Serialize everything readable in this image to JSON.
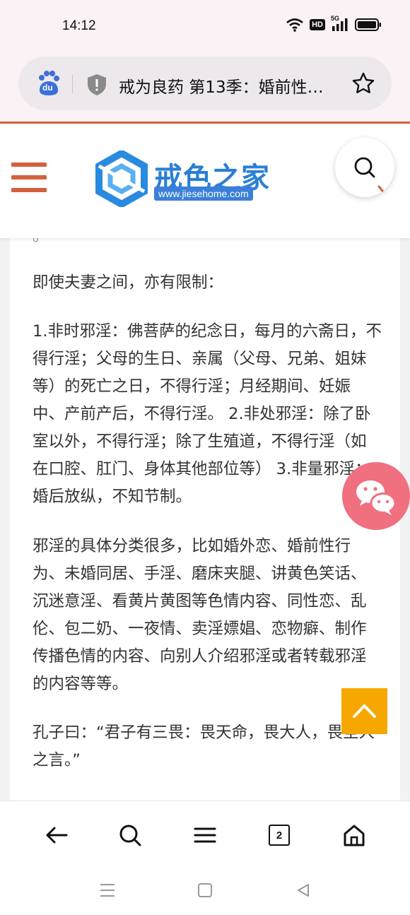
{
  "status_bar": {
    "time": "14:12",
    "icons": [
      "wifi-icon",
      "hd-icon",
      "5g-signal-icon",
      "battery-icon"
    ],
    "hd_label": "HD",
    "network_label": "5G"
  },
  "browser": {
    "page_title": "戒为良药 第13季：婚前性…",
    "engine_icon": "baidu-paw-icon",
    "engine_label": "du"
  },
  "site": {
    "logo_name": "戒色之家",
    "logo_url": "www.jiesehome.com",
    "accent_color": "#d4603c",
    "brand_color": "#2a7fd4"
  },
  "article": {
    "cut_line": "。",
    "paragraphs": [
      "即使夫妻之间，亦有限制：",
      "1.非时邪淫：佛菩萨的纪念日，每月的六斋日，不得行淫；父母的生日、亲属（父母、兄弟、姐妹等）的死亡之日，不得行淫；月经期间、妊娠中、产前产后，不得行淫。 2.非处邪淫：除了卧室以外，不得行淫；除了生殖道，不得行淫（如在口腔、肛门、身体其他部位等） 3.非量邪淫：婚后放纵，不知节制。",
      "邪淫的具体分类很多，比如婚外恋、婚前性行为、未婚同居、手淫、磨床夹腿、讲黄色笑话、沉迷意淫、看黄片黄图等色情内容、同性恋、乱伦、包二奶、一夜情、卖淫嫖娼、恋物癖、制作传播色情的内容、向别人介绍邪淫或者转载邪淫的内容等等。",
      "孔子曰：“君子有三畏：畏天命，畏大人，畏圣人之言。”"
    ]
  },
  "floating": {
    "wechat_color": "#f07080",
    "totop_color": "#f6a700"
  },
  "bottom_nav": {
    "tab_count": "2"
  }
}
